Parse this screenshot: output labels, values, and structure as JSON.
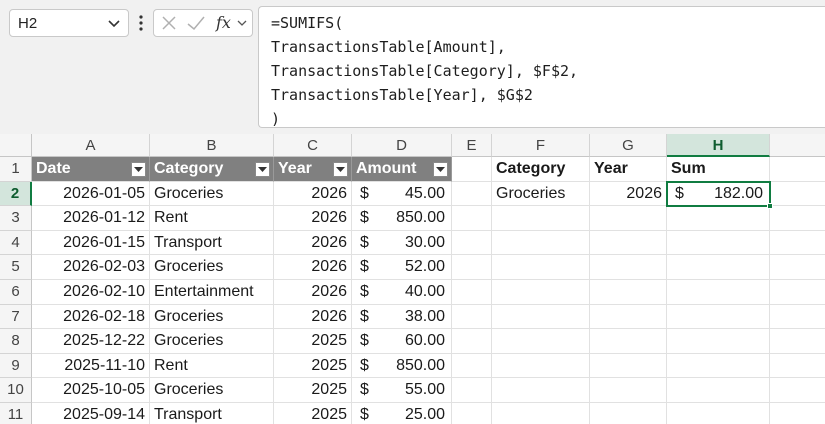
{
  "name_box": {
    "value": "H2"
  },
  "formula_bar": {
    "lines": [
      "=SUMIFS(",
      "TransactionsTable[Amount],",
      "TransactionsTable[Category], $F$2,",
      "TransactionsTable[Year], $G$2",
      ")"
    ]
  },
  "grid": {
    "columns": [
      "A",
      "B",
      "C",
      "D",
      "E",
      "F",
      "G",
      "H"
    ],
    "rows": [
      "1",
      "2",
      "3",
      "4",
      "5",
      "6",
      "7",
      "8",
      "9",
      "10",
      "11"
    ],
    "selected_column": "H",
    "selected_row": "2"
  },
  "table": {
    "headers": [
      "Date",
      "Category",
      "Year",
      "Amount"
    ],
    "currency_symbol": "$",
    "rows": [
      {
        "date": "2026-01-05",
        "category": "Groceries",
        "year": "2026",
        "amount": "45.00"
      },
      {
        "date": "2026-01-12",
        "category": "Rent",
        "year": "2026",
        "amount": "850.00"
      },
      {
        "date": "2026-01-15",
        "category": "Transport",
        "year": "2026",
        "amount": "30.00"
      },
      {
        "date": "2026-02-03",
        "category": "Groceries",
        "year": "2026",
        "amount": "52.00"
      },
      {
        "date": "2026-02-10",
        "category": "Entertainment",
        "year": "2026",
        "amount": "40.00"
      },
      {
        "date": "2026-02-18",
        "category": "Groceries",
        "year": "2026",
        "amount": "38.00"
      },
      {
        "date": "2025-12-22",
        "category": "Groceries",
        "year": "2025",
        "amount": "60.00"
      },
      {
        "date": "2025-11-10",
        "category": "Rent",
        "year": "2025",
        "amount": "850.00"
      },
      {
        "date": "2025-10-05",
        "category": "Groceries",
        "year": "2025",
        "amount": "55.00"
      },
      {
        "date": "2025-09-14",
        "category": "Transport",
        "year": "2025",
        "amount": "25.00"
      }
    ]
  },
  "summary": {
    "headers": [
      "Category",
      "Year",
      "Sum"
    ],
    "category": "Groceries",
    "year": "2026",
    "currency_symbol": "$",
    "sum": "182.00"
  },
  "colors": {
    "table_header_bg": "#808080",
    "selection_accent": "#107c41",
    "toolbar_bg": "#f1f1f1"
  },
  "icons": [
    "chevron-down-icon",
    "more-options-icon",
    "cancel-icon",
    "enter-icon",
    "insert-function-icon"
  ]
}
